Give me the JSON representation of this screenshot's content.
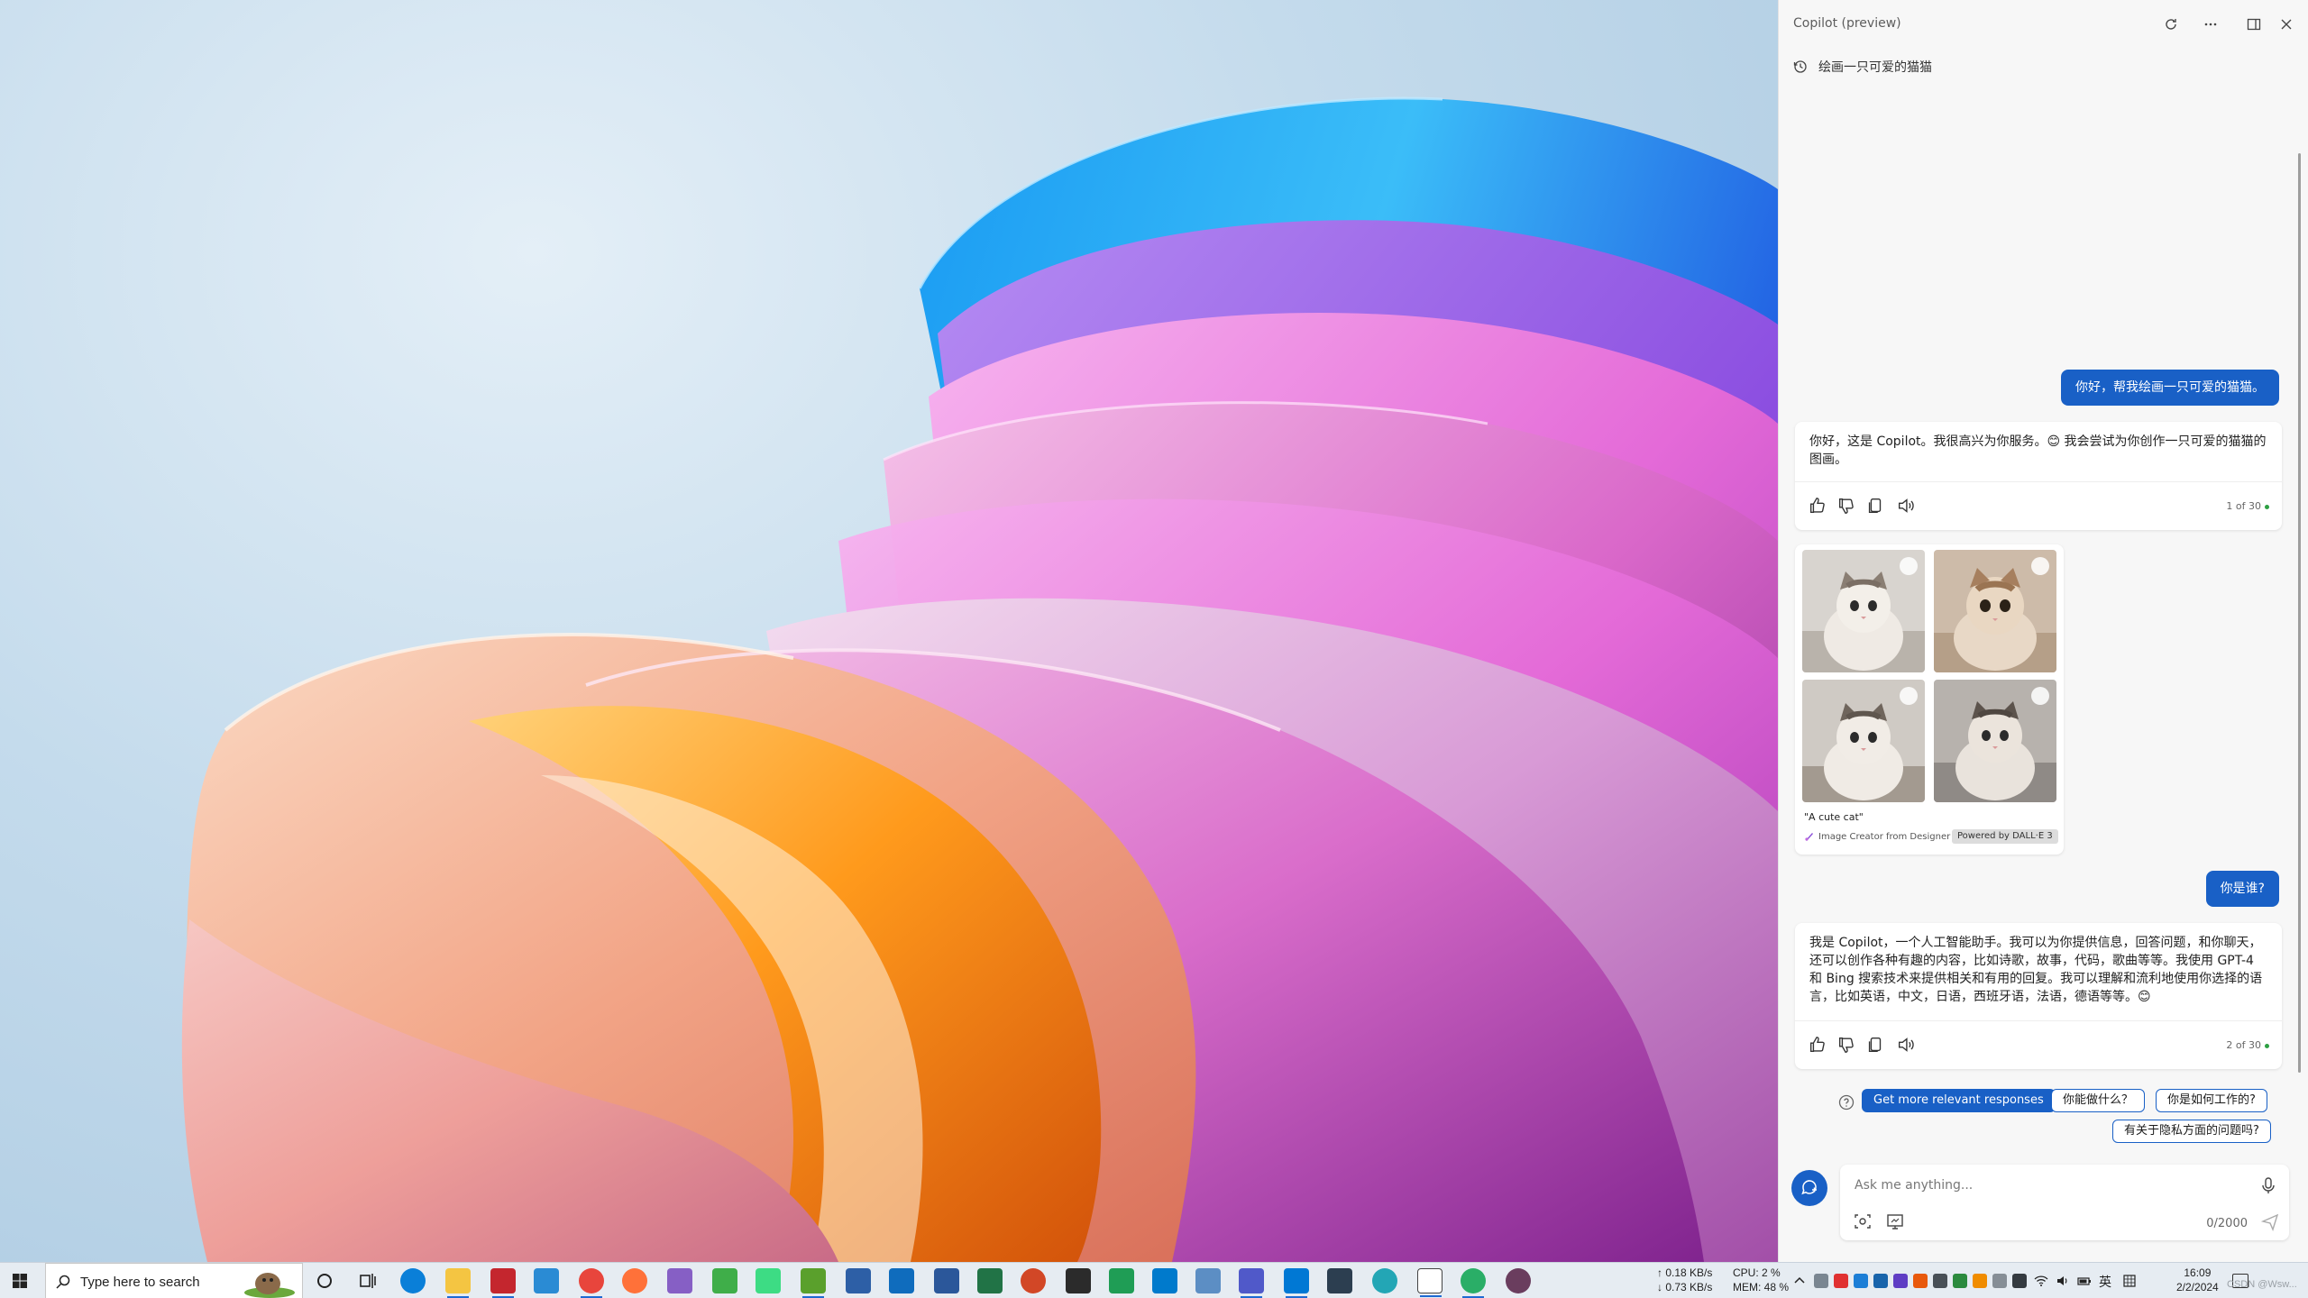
{
  "copilot": {
    "title": "Copilot (preview)",
    "history_label": "绘画一只可爱的猫猫",
    "messages": [
      {
        "role": "user",
        "text": "你好，帮我绘画一只可爱的猫猫。"
      },
      {
        "role": "bot",
        "text": "你好，这是 Copilot。我很高兴为你服务。😊 我会尝试为你创作一只可爱的猫猫的图画。",
        "counter": "1 of 30"
      },
      {
        "role": "images",
        "caption": "\"A cute cat\"",
        "source": "Image Creator from Designer",
        "powered": "Powered by DALL·E 3"
      },
      {
        "role": "user",
        "text": "你是谁?"
      },
      {
        "role": "bot",
        "text": "我是 Copilot，一个人工智能助手。我可以为你提供信息，回答问题，和你聊天，还可以创作各种有趣的内容，比如诗歌，故事，代码，歌曲等等。我使用 GPT-4 和 Bing 搜索技术来提供相关和有用的回复。我可以理解和流利地使用你选择的语言，比如英语，中文，日语，西班牙语，法语，德语等等。😊",
        "counter": "2 of 30"
      }
    ],
    "suggestions": [
      "Get more relevant responses",
      "你能做什么？",
      "你是如何工作的?",
      "有关于隐私方面的问题吗?"
    ],
    "input": {
      "placeholder": "Ask me anything...",
      "char_count": "0/2000"
    }
  },
  "taskbar": {
    "search_placeholder": "Type here to search",
    "net_up": "↑ 0.18 KB/s",
    "net_down": "↓ 0.73 KB/s",
    "cpu": "CPU: 2 %",
    "mem": "MEM: 48 %",
    "lang": "英",
    "time": "16:09",
    "date": "2/2/2024",
    "watermark": "CSDN @Wsw..."
  },
  "colors": {
    "accent": "#1960c6",
    "panel_bg": "#f7f7f7",
    "taskbar_bg": "#e6ecf2"
  }
}
